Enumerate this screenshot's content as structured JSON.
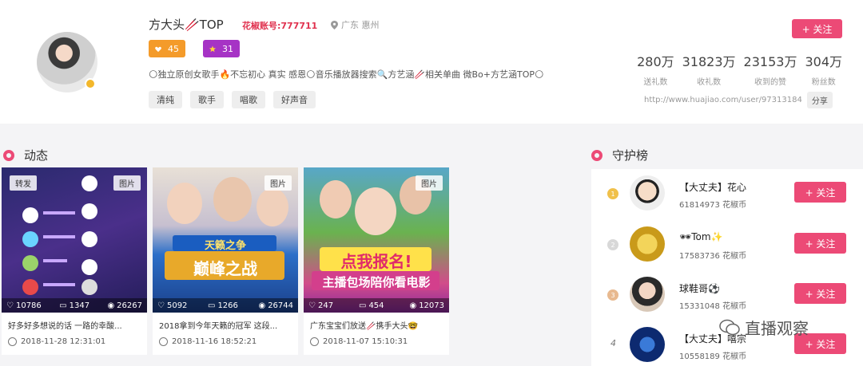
{
  "profile": {
    "name": "方大头🥢TOP",
    "flower_id": "花椒账号:777711",
    "location": "广东 惠州",
    "badge_level": "45",
    "badge_star": "31",
    "bio": "🌕独立原创女歌手🔥不忘初心 真实 感恩🌕音乐播放器搜索🔍方艺涵🥢相关单曲 微Bo+方艺涵TOP🌕",
    "tags": [
      "清纯",
      "歌手",
      "唱歌",
      "好声音"
    ],
    "follow_label": "+ 关注",
    "stats": [
      {
        "value": "280万",
        "label": "送礼数"
      },
      {
        "value": "31823万",
        "label": "收礼数"
      },
      {
        "value": "23153万",
        "label": "收到的赞"
      },
      {
        "value": "304万",
        "label": "粉丝数"
      }
    ],
    "url": "http://www.huajiao.com/user/97313184",
    "share_label": "分享"
  },
  "feed": {
    "title": "动态",
    "cards": [
      {
        "tag_left": "转发",
        "tag_right": "图片",
        "likes": "10786",
        "comments": "1347",
        "views": "26267",
        "caption": "好多好多想说的话 一路的幸酸...",
        "time": "2018-11-28 12:31:01"
      },
      {
        "tag_right": "图片",
        "likes": "5092",
        "comments": "1266",
        "views": "26744",
        "caption": "2018拿到今年天籁的冠军 这段...",
        "time": "2018-11-16 18:52:21",
        "poster_text_1": "天籁之争",
        "poster_text_2": "巅峰之战"
      },
      {
        "tag_right": "图片",
        "likes": "247",
        "comments": "454",
        "views": "12073",
        "caption": "广东宝宝们放送🥢携手大头🤓",
        "time": "2018-11-07 15:10:31",
        "poster_text_1": "点我报名!",
        "poster_text_2": "主播包场陪你看电影"
      }
    ]
  },
  "guard": {
    "title": "守护榜",
    "follow_label": "+ 关注",
    "rows": [
      {
        "rank": "1",
        "name": "【大丈夫】花心",
        "coins": "61814973 花椒币",
        "rank_color": "#f0c04a"
      },
      {
        "rank": "2",
        "name": "🕶Tom✨",
        "coins": "17583736 花椒币",
        "rank_color": "#d8d8d8"
      },
      {
        "rank": "3",
        "name": "球鞋哥⚽",
        "coins": "15331048 花椒币",
        "rank_color": "#e8b98f"
      },
      {
        "rank": "4",
        "name": "【大丈夫】嘻宗",
        "coins": "10558189 花椒币"
      }
    ]
  },
  "watermark": "直播观察",
  "colors": {
    "accent": "#ec4a76",
    "orange": "#f49b2a",
    "purple": "#a633c5"
  }
}
